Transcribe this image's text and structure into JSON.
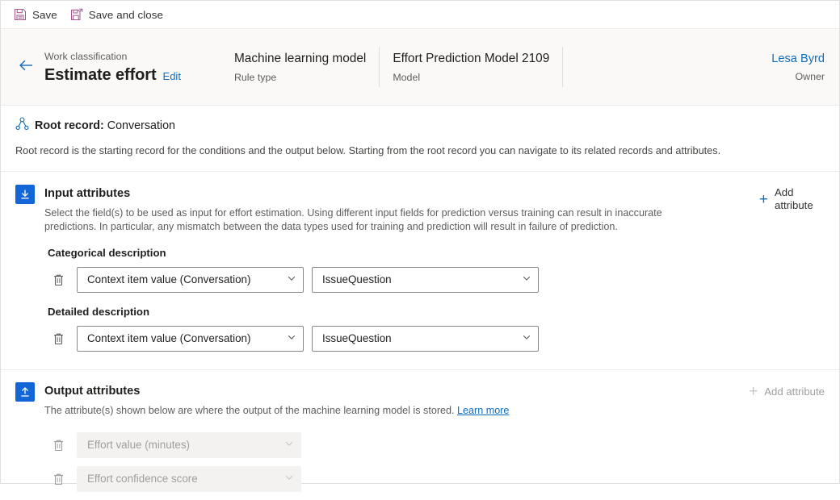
{
  "command_bar": {
    "buttons": [
      {
        "label": "Save",
        "icon": "save-icon"
      },
      {
        "label": "Save and close",
        "icon": "save-and-close-icon"
      }
    ]
  },
  "header": {
    "back_icon": "back-arrow-icon",
    "eyebrow": "Work classification",
    "title": "Estimate effort",
    "edit_label": "Edit",
    "fields": [
      {
        "value": "Machine learning model",
        "label": "Rule type"
      },
      {
        "value": "Effort Prediction Model 2109",
        "label": "Model"
      }
    ],
    "owner": {
      "name": "Lesa Byrd",
      "label": "Owner"
    }
  },
  "root_record": {
    "icon": "hierarchy-icon",
    "title_strong": "Root record:",
    "title_value": " Conversation",
    "description": "Root record is the starting record for the conditions and the output below. Starting from the root record you can navigate to its related records and attributes."
  },
  "input_section": {
    "icon": "download-arrow-icon",
    "title": "Input attributes",
    "description": "Select the field(s) to be used as input for effort estimation. Using different input fields for prediction versus training can result in inaccurate predictions. In particular, any mismatch between the data types used for training and prediction will result in failure of prediction.",
    "add_attribute": {
      "label": "Add attribute",
      "icon": "plus-icon",
      "disabled": false
    },
    "groups": [
      {
        "label": "Categorical description",
        "row": {
          "delete_icon": "trash-icon",
          "source": "Context item value (Conversation)",
          "field": "IssueQuestion"
        }
      },
      {
        "label": "Detailed description",
        "row": {
          "delete_icon": "trash-icon",
          "source": "Context item value (Conversation)",
          "field": "IssueQuestion"
        }
      }
    ]
  },
  "output_section": {
    "icon": "upload-arrow-icon",
    "title": "Output attributes",
    "description": "The attribute(s) shown below are where the output of the machine learning model is stored. ",
    "learn_more": "Learn more",
    "add_attribute": {
      "label": "Add attribute",
      "icon": "plus-icon",
      "disabled": true
    },
    "rows": [
      {
        "delete_icon": "trash-icon",
        "value": "Effort value (minutes)",
        "disabled": true
      },
      {
        "delete_icon": "trash-icon",
        "value": "Effort confidence score",
        "disabled": true
      }
    ]
  },
  "colors": {
    "accent_blue": "#0f6cbd",
    "section_icon_bg": "#1366d6",
    "header_bg": "#faf9f8",
    "command_icon": "#a4588f",
    "disabled_text": "#a19f9d",
    "border": "#e1dfdd"
  }
}
